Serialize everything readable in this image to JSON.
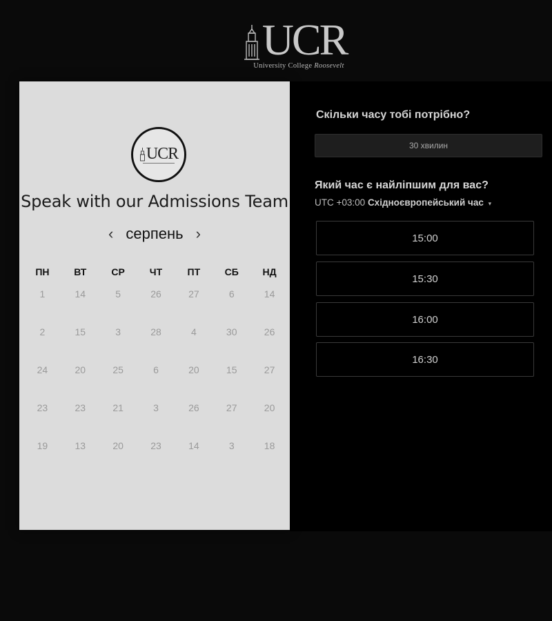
{
  "header": {
    "logo_text": "UCR",
    "logo_subtitle_plain": "University College",
    "logo_subtitle_italic": "Roosevelt"
  },
  "calendar": {
    "badge_text": "UCR",
    "title": "Speak with our Admissions Team",
    "month": "серпень",
    "prev_icon": "‹",
    "next_icon": "›",
    "weekdays": [
      "ПН",
      "ВТ",
      "СР",
      "ЧТ",
      "ПТ",
      "СБ",
      "НД"
    ],
    "days": [
      "1",
      "14",
      "5",
      "26",
      "27",
      "6",
      "14",
      "2",
      "15",
      "3",
      "28",
      "4",
      "30",
      "26",
      "24",
      "20",
      "25",
      "6",
      "20",
      "15",
      "27",
      "23",
      "23",
      "21",
      "3",
      "26",
      "27",
      "20",
      "19",
      "13",
      "20",
      "23",
      "14",
      "3",
      "18"
    ]
  },
  "booking": {
    "duration_question": "Скільки часу тобі потрібно?",
    "duration_value": "30 хвилин",
    "time_question": "Який час є найліпшим для вас?",
    "timezone_offset": "UTC +03:00",
    "timezone_name": "Східноєвропейський час",
    "timezone_caret": "▾",
    "slots": [
      "15:00",
      "15:30",
      "16:00",
      "16:30"
    ]
  },
  "colors": {
    "page_bg": "#0a0a0a",
    "calendar_bg": "#dcdcdc",
    "booking_bg": "#000000",
    "slot_border": "#3a3a3a"
  }
}
